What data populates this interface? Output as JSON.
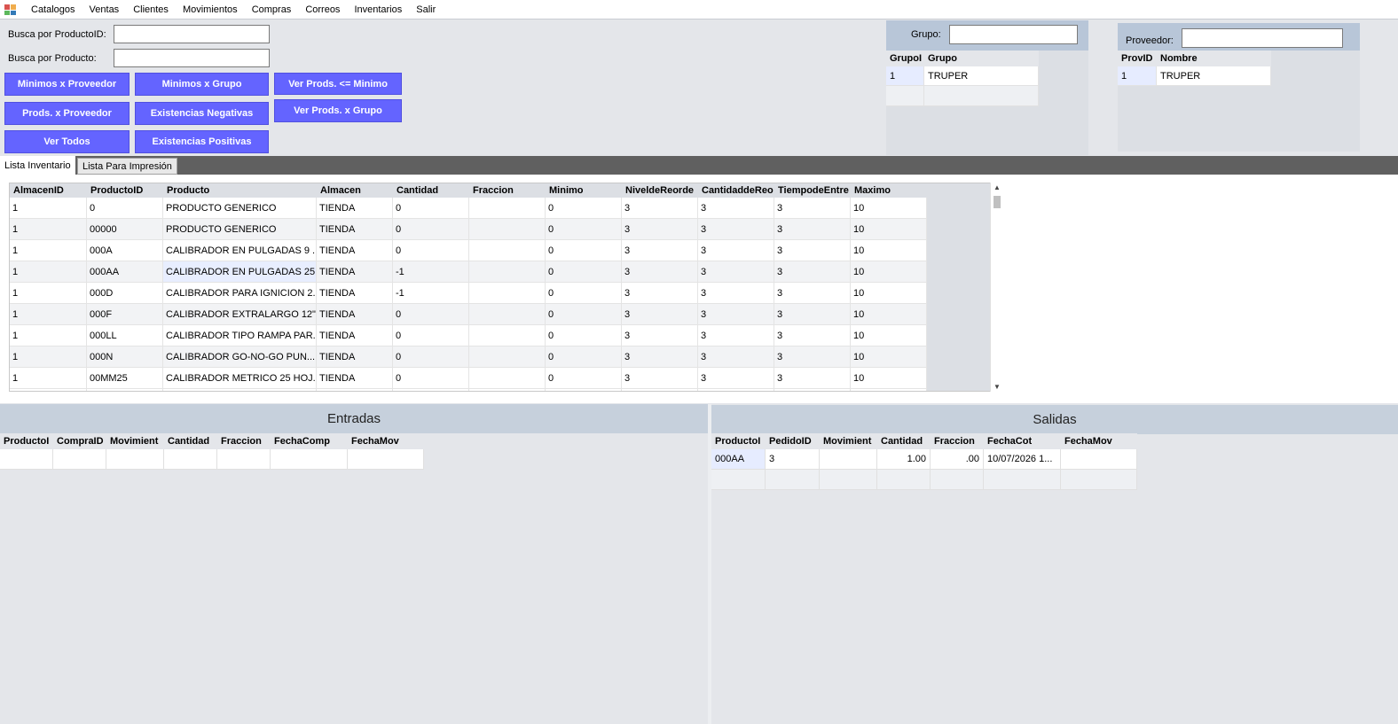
{
  "menu": [
    "Catalogos",
    "Ventas",
    "Clientes",
    "Movimientos",
    "Compras",
    "Correos",
    "Inventarios",
    "Salir"
  ],
  "search": {
    "by_id_label": "Busca por ProductoID:",
    "by_id_value": "",
    "by_name_label": "Busca por Producto:",
    "by_name_value": ""
  },
  "buttons": {
    "min_proveedor": "Minimos x Proveedor",
    "min_grupo": "Minimos x Grupo",
    "ver_min": "Ver Prods. <= Minimo",
    "prods_proveedor": "Prods. x Proveedor",
    "exist_neg": "Existencias Negativas",
    "ver_grupo": "Ver Prods. x Grupo",
    "ver_todos": "Ver Todos",
    "exist_pos": "Existencias Positivas"
  },
  "grupo": {
    "label": "Grupo:",
    "value": "",
    "headers": [
      "GrupoI",
      "Grupo"
    ],
    "rows": [
      [
        "1",
        "TRUPER"
      ]
    ]
  },
  "proveedor": {
    "label": "Proveedor:",
    "value": "",
    "headers": [
      "ProvID",
      "Nombre"
    ],
    "rows": [
      [
        "1",
        "TRUPER"
      ]
    ]
  },
  "tabs": [
    "Lista Inventario",
    "Lista Para Impresión"
  ],
  "inventory": {
    "headers": [
      "AlmacenID",
      "ProductoID",
      "Producto",
      "Almacen",
      "Cantidad",
      "Fraccion",
      "Minimo",
      "NiveldeReorde",
      "CantidaddeReo",
      "TiempodeEntre",
      "Maximo"
    ],
    "rows": [
      [
        "1",
        "0",
        "PRODUCTO GENERICO",
        "TIENDA",
        "0",
        "",
        "0",
        "3",
        "3",
        "3",
        "10"
      ],
      [
        "1",
        "00000",
        "PRODUCTO GENERICO",
        "TIENDA",
        "0",
        "",
        "0",
        "3",
        "3",
        "3",
        "10"
      ],
      [
        "1",
        "000A",
        "CALIBRADOR EN PULGADAS 9 ...",
        "TIENDA",
        "0",
        "",
        "0",
        "3",
        "3",
        "3",
        "10"
      ],
      [
        "1",
        "000AA",
        "CALIBRADOR EN PULGADAS 25...",
        "TIENDA",
        "-1",
        "",
        "0",
        "3",
        "3",
        "3",
        "10"
      ],
      [
        "1",
        "000D",
        "CALIBRADOR PARA IGNICION 2...",
        "TIENDA",
        "-1",
        "",
        "0",
        "3",
        "3",
        "3",
        "10"
      ],
      [
        "1",
        "000F",
        "CALIBRADOR EXTRALARGO 12\"...",
        "TIENDA",
        "0",
        "",
        "0",
        "3",
        "3",
        "3",
        "10"
      ],
      [
        "1",
        "000LL",
        "CALIBRADOR TIPO RAMPA PAR...",
        "TIENDA",
        "0",
        "",
        "0",
        "3",
        "3",
        "3",
        "10"
      ],
      [
        "1",
        "000N",
        "CALIBRADOR GO-NO-GO PUN...",
        "TIENDA",
        "0",
        "",
        "0",
        "3",
        "3",
        "3",
        "10"
      ],
      [
        "1",
        "00MM25",
        "CALIBRADOR METRICO 25 HOJ...",
        "TIENDA",
        "0",
        "",
        "0",
        "3",
        "3",
        "3",
        "10"
      ]
    ]
  },
  "entradas": {
    "title": "Entradas",
    "headers": [
      "ProductoI",
      "CompraID",
      "Movimient",
      "Cantidad",
      "Fraccion",
      "FechaComp",
      "FechaMov"
    ]
  },
  "salidas": {
    "title": "Salidas",
    "headers": [
      "ProductoI",
      "PedidoID",
      "Movimient",
      "Cantidad",
      "Fraccion",
      "FechaCot",
      "FechaMov"
    ],
    "rows": [
      [
        "000AA",
        "3",
        "",
        "1.00",
        ".00",
        "10/07/2026 1...",
        ""
      ]
    ]
  }
}
